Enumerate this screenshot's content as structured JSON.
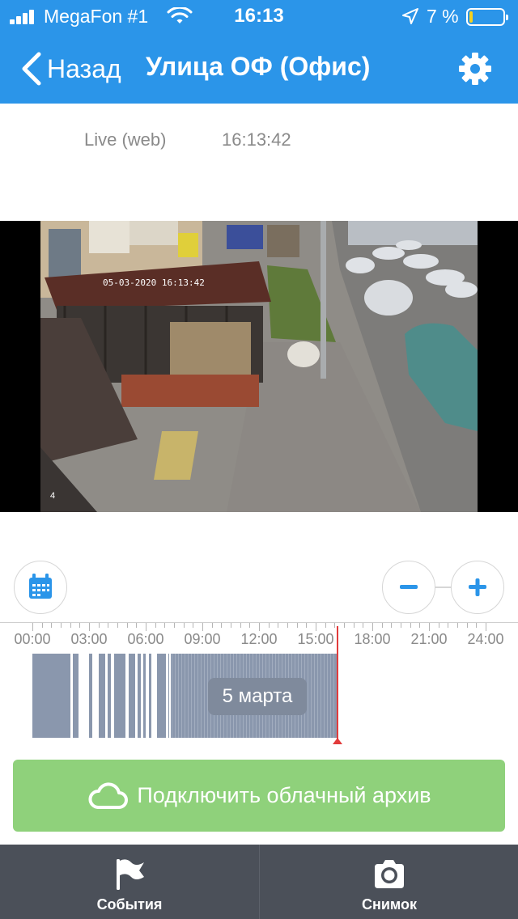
{
  "status_bar": {
    "carrier": "MegaFon #1",
    "time": "16:13",
    "battery_percent": "7 %",
    "battery_level": 0.07
  },
  "nav": {
    "back_label": "Назад",
    "title": "Улица ОФ (Офис)"
  },
  "stream": {
    "mode_label": "Live (web)",
    "time": "16:13:42"
  },
  "camera": {
    "overlay_timestamp": "05-03-2020 16:13:42",
    "channel": "4"
  },
  "timeline": {
    "tick_labels": [
      "00:00",
      "03:00",
      "06:00",
      "09:00",
      "12:00",
      "15:00",
      "18:00",
      "21:00",
      "24:00"
    ],
    "date_label": "5 марта",
    "playhead_time": "16:13"
  },
  "cloud_button": {
    "label": "Подключить облачный архив"
  },
  "tabbar": {
    "events_label": "События",
    "snapshot_label": "Снимок"
  },
  "colors": {
    "accent": "#2b95e9",
    "cloud_button": "#8fd17b",
    "archive": "#8a97ad",
    "playhead": "#e23b3b",
    "tabbar": "#4b5059"
  },
  "icons": {
    "back": "chevron-left-icon",
    "settings": "gear-icon",
    "calendar": "calendar-icon",
    "zoom_out": "minus-icon",
    "zoom_in": "plus-icon",
    "cloud": "cloud-icon",
    "events": "flag-icon",
    "snapshot": "camera-icon"
  }
}
